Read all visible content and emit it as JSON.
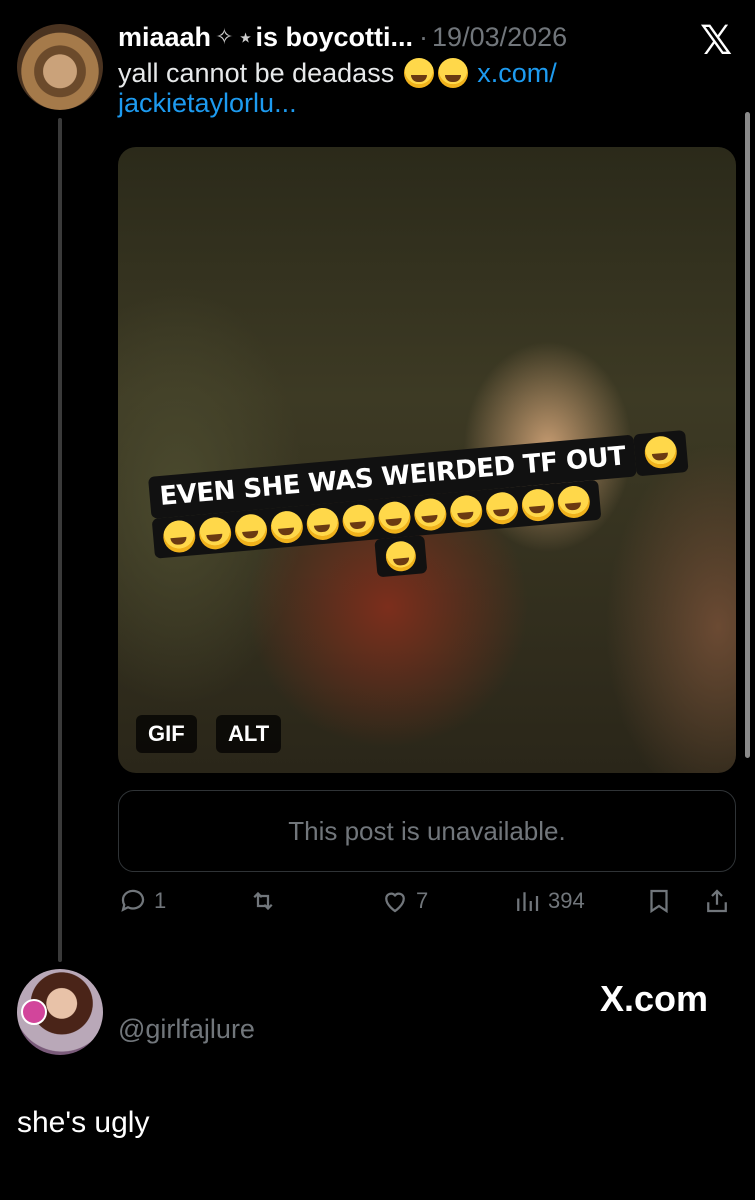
{
  "post": {
    "display_name": "miaaah",
    "name_glyphs": "✧ ⭑",
    "name_suffix": "is boycotti...",
    "separator": "·",
    "date": "19/03/2026",
    "text_prefix": "yall cannot be deadass",
    "link_line1": "x.com/",
    "link_line2": "jackietaylorlu...",
    "media": {
      "caption": "EVEN SHE WAS WEIRDED TF OUT",
      "badges": [
        "GIF",
        "ALT"
      ]
    },
    "quote_unavailable": "This post is unavailable.",
    "actions": {
      "replies": "1",
      "reposts": "",
      "likes": "7",
      "views": "394"
    }
  },
  "footer": {
    "brand": "X.com",
    "handle": "@girlfajlure",
    "reply_text": "she's ugly"
  },
  "icons": {
    "close": "x-logo-icon",
    "emoji": "loudly-crying-face-icon"
  },
  "colors": {
    "background": "#000000",
    "text": "#e7e9ea",
    "muted": "#71767b",
    "link": "#1d9bf0"
  }
}
